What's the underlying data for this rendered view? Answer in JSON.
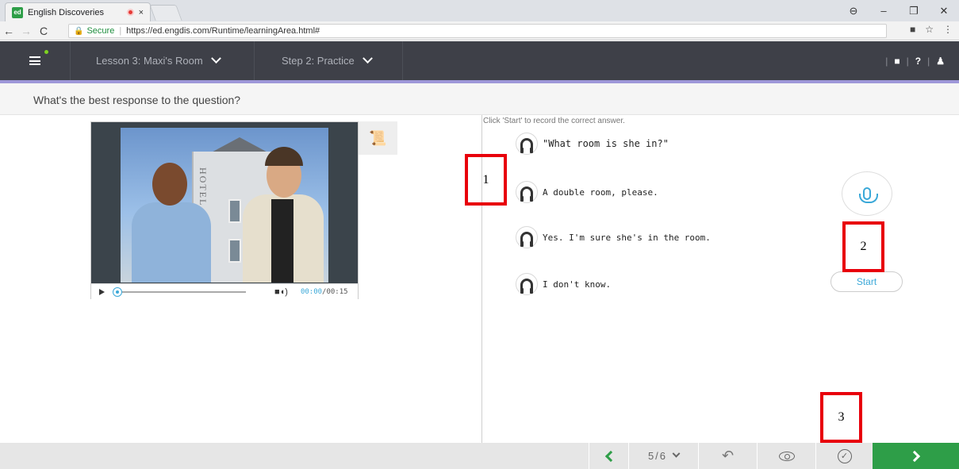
{
  "browser": {
    "tab_icon_label": "ed",
    "tab_title": "English Discoveries",
    "tab_close": "×",
    "secure_label": "Secure",
    "url": "https://ed.engdis.com/Runtime/learningArea.html#",
    "window_controls": [
      "⊖",
      "–",
      "❐",
      "✕"
    ]
  },
  "header": {
    "lesson_label": "Lesson 3: Maxi's Room",
    "step_label": "Step 2: Practice",
    "right_icons": [
      "|",
      "■",
      "|",
      "?",
      "|",
      "♟"
    ]
  },
  "question": "What's the best response to the question?",
  "video": {
    "sign_text": "HOTEL",
    "current_time": "00:00",
    "duration": "/00:15",
    "progress": 0
  },
  "exercise": {
    "instruction": "Click 'Start' to record the correct answer.",
    "prompt": "\"What room is she in?\"",
    "options": [
      "A double room, please.",
      "Yes. I'm sure she's in the room.",
      "I don't know."
    ],
    "start_label": "Start"
  },
  "annotations": [
    "1",
    "2",
    "3"
  ],
  "footer": {
    "page": "5/6"
  }
}
